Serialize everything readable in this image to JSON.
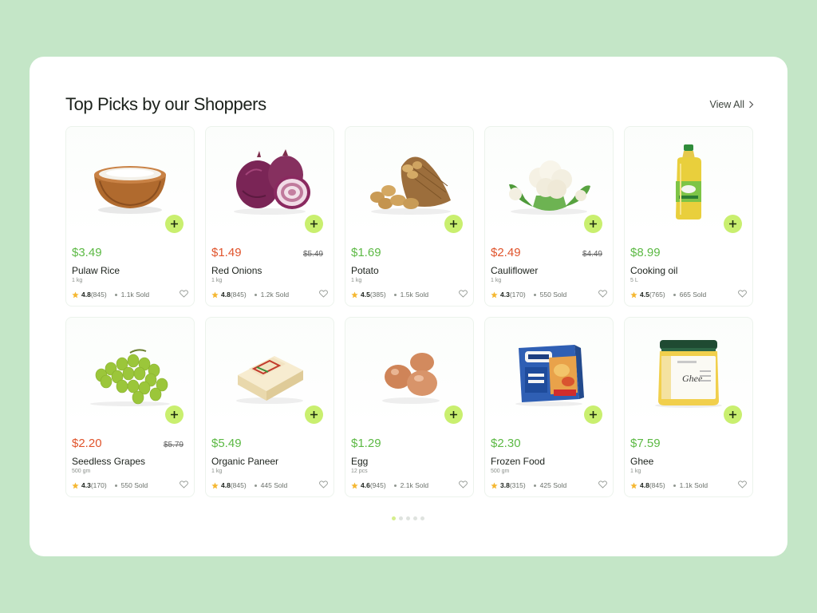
{
  "section": {
    "title": "Top Picks by our Shoppers",
    "view_all": "View All"
  },
  "colors": {
    "background": "#c4e6c7",
    "price_green": "#5cb944",
    "price_sale": "#e0542c",
    "add_button": "#c9ef6f"
  },
  "products": [
    {
      "name": "Pulaw Rice",
      "price": "$3.49",
      "old_price": "",
      "weight": "1 kg",
      "rating": "4.8",
      "reviews": "(845)",
      "sold": "1.1k Sold",
      "image": "rice-bowl"
    },
    {
      "name": "Red Onions",
      "price": "$1.49",
      "old_price": "$5.49",
      "weight": "1 kg",
      "rating": "4.8",
      "reviews": "(845)",
      "sold": "1.2k Sold",
      "image": "red-onion"
    },
    {
      "name": "Potato",
      "price": "$1.69",
      "old_price": "",
      "weight": "1 kg",
      "rating": "4.5",
      "reviews": "(385)",
      "sold": "1.5k Sold",
      "image": "potato-sack"
    },
    {
      "name": "Cauliflower",
      "price": "$2.49",
      "old_price": "$4.49",
      "weight": "1 kg",
      "rating": "4.3",
      "reviews": "(170)",
      "sold": "550 Sold",
      "image": "cauliflower"
    },
    {
      "name": "Cooking oil",
      "price": "$8.99",
      "old_price": "",
      "weight": "5 L",
      "rating": "4.5",
      "reviews": "(765)",
      "sold": "665 Sold",
      "image": "oil-bottle"
    },
    {
      "name": "Seedless Grapes",
      "price": "$2.20",
      "old_price": "$5.79",
      "weight": "500 gm",
      "rating": "4.3",
      "reviews": "(170)",
      "sold": "550 Sold",
      "image": "grapes"
    },
    {
      "name": "Organic Paneer",
      "price": "$5.49",
      "old_price": "",
      "weight": "1 kg",
      "rating": "4.8",
      "reviews": "(845)",
      "sold": "445 Sold",
      "image": "paneer-block"
    },
    {
      "name": "Egg",
      "price": "$1.29",
      "old_price": "",
      "weight": "12 pcs",
      "rating": "4.6",
      "reviews": "(945)",
      "sold": "2.1k Sold",
      "image": "eggs"
    },
    {
      "name": "Frozen Food",
      "price": "$2.30",
      "old_price": "",
      "weight": "500 gm",
      "rating": "3.8",
      "reviews": "(315)",
      "sold": "425 Sold",
      "image": "frozen-box"
    },
    {
      "name": "Ghee",
      "price": "$7.59",
      "old_price": "",
      "weight": "1 kg",
      "rating": "4.8",
      "reviews": "(845)",
      "sold": "1.1k Sold",
      "image": "ghee-jar"
    }
  ],
  "pagination": {
    "pages": 5,
    "active": 1
  }
}
